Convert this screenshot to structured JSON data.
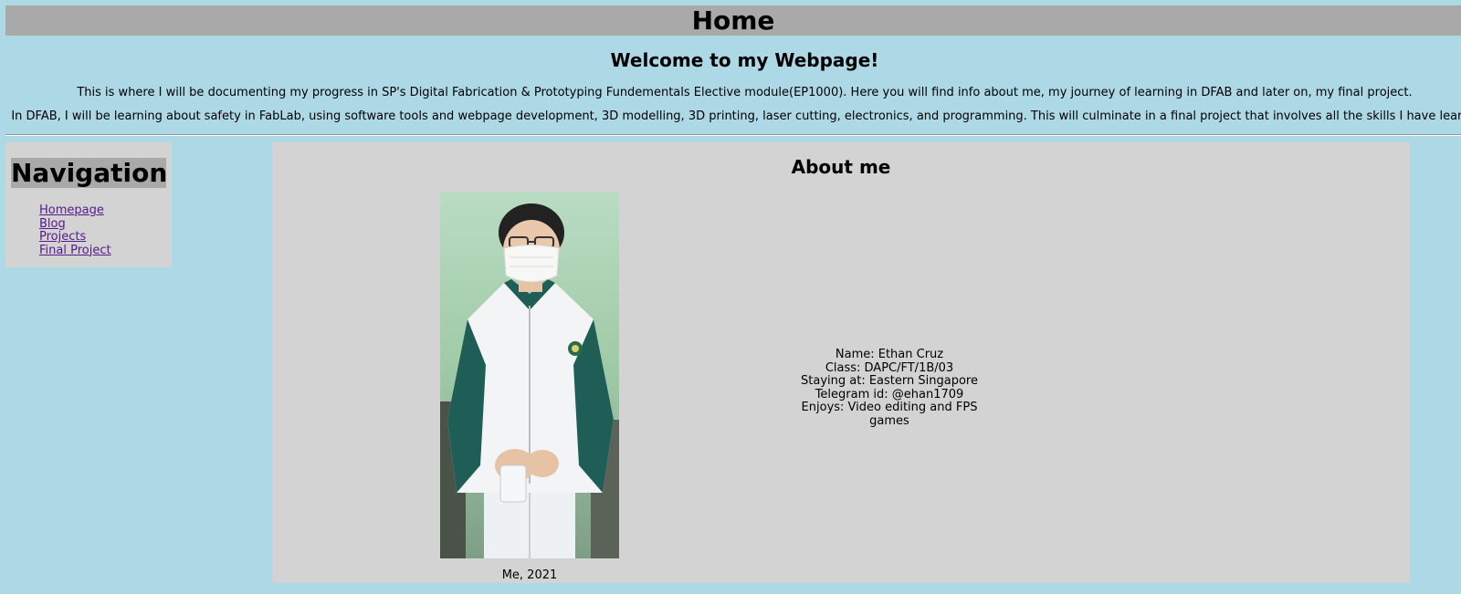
{
  "header": {
    "title": "Home"
  },
  "intro": {
    "welcome": "Welcome to my Webpage!",
    "paragraph_1": "This is where I will be documenting my progress in SP's Digital Fabrication & Prototyping Fundementals Elective module(EP1000). Here you will find info about me, my journey of learning in DFAB and later on, my final project.",
    "paragraph_2": "In DFAB, I will be learning about safety in FabLab, using software tools and webpage development, 3D modelling, 3D printing, laser cutting, electronics, and programming. This will culminate in a final project that involves all the skills I have learnt."
  },
  "nav": {
    "title": "Navigation",
    "items": [
      {
        "label": "Homepage"
      },
      {
        "label": "Blog"
      },
      {
        "label": "Projects"
      },
      {
        "label": "Final Project"
      }
    ]
  },
  "about": {
    "title": "About me",
    "photo_caption": "Me, 2021",
    "details": {
      "name": "Name: Ethan Cruz",
      "class": "Class: DAPC/FT/1B/03",
      "staying": "Staying at: Eastern Singapore",
      "telegram": "Telegram id: @ehan1709",
      "enjoys": "Enjoys: Video editing and FPS games"
    }
  }
}
